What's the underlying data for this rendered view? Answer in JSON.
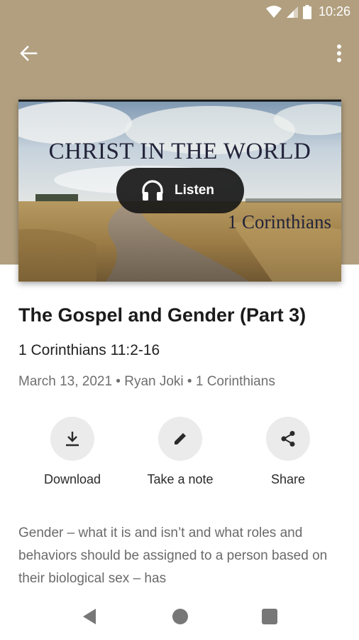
{
  "status_bar": {
    "time": "10:26"
  },
  "app_bar": {
    "back_icon": "arrow-back-icon",
    "more_icon": "more-vert-icon"
  },
  "artwork": {
    "title": "CHRIST IN THE WORLD",
    "subtitle": "1 Corinthians"
  },
  "listen_button": {
    "label": "Listen",
    "icon": "headphones-icon"
  },
  "sermon": {
    "title": "The Gospel and Gender (Part 3)",
    "scripture": "1 Corinthians 11:2-16",
    "meta": "March 13, 2021 • Ryan Joki • 1 Corinthians"
  },
  "actions": [
    {
      "label": "Download",
      "icon": "download-icon"
    },
    {
      "label": "Take a note",
      "icon": "pencil-icon"
    },
    {
      "label": "Share",
      "icon": "share-icon"
    }
  ],
  "description": "Gender – what it is and isn’t and what roles and behaviors should be assigned to a person based on their biological sex – has",
  "colors": {
    "header_bg": "#b19f7f",
    "button_bg": "#181818",
    "action_circle": "#ebebeb"
  }
}
